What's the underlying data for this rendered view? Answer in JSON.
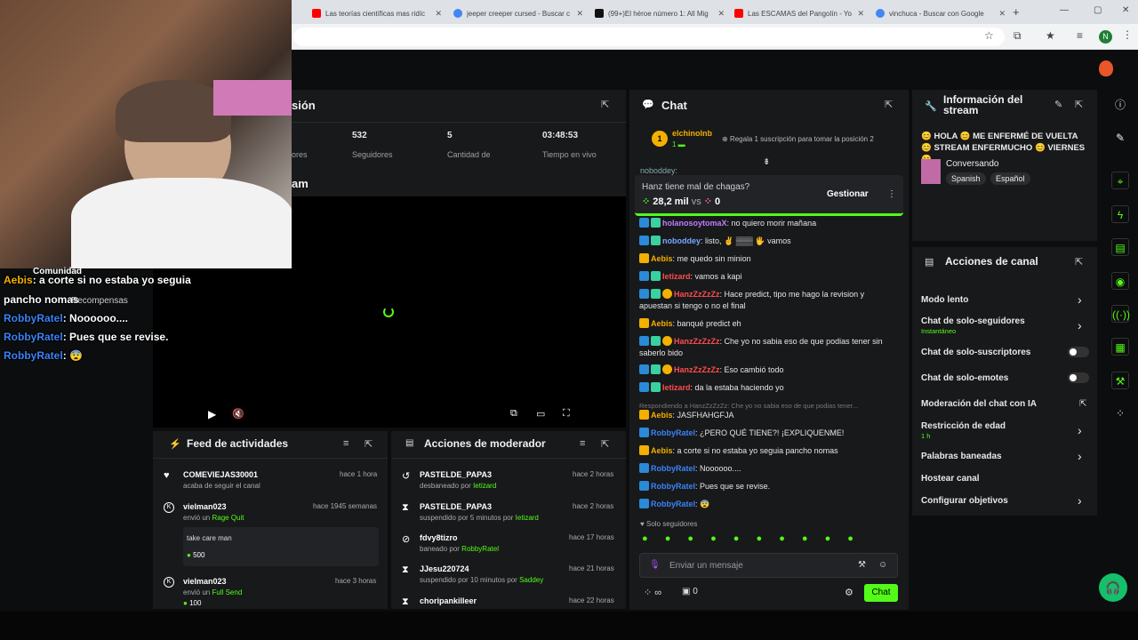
{
  "browser": {
    "tabs": [
      {
        "title": "Las teorías científicas mas ridíc",
        "color": "#ff0000"
      },
      {
        "title": "jeeper creeper cursed - Buscar c",
        "color": "#4285f4"
      },
      {
        "title": "(99+)El héroe número 1: All Mig",
        "color": "#111111"
      },
      {
        "title": "Las ESCAMAS del Pangolín - Yo",
        "color": "#ff0000"
      },
      {
        "title": "vinchuca - Buscar con Google",
        "color": "#4285f4"
      }
    ],
    "new_tab": "+",
    "profile_initial": "N",
    "window_controls": [
      "—",
      "▢",
      "✕"
    ]
  },
  "stream_info": {
    "title_partial": "sión",
    "stats": [
      {
        "value": "",
        "label": "ores"
      },
      {
        "value": "532",
        "label": "Seguidores"
      },
      {
        "value": "5",
        "label": "Cantidad de"
      },
      {
        "value": "03:48:53",
        "label": "Tiempo en vivo"
      }
    ],
    "player_title_partial": "am"
  },
  "overlay": {
    "community_label": "Comunidad",
    "lines": [
      {
        "user": "Aebis",
        "text": " a corte si no estaba yo seguia",
        "color": "#f3b000"
      },
      {
        "user": "",
        "text": "pancho nomas",
        "color": "#ffffff"
      },
      {
        "user": "RobbyRatel",
        "text": "Noooooo....",
        "color": "#3b82f6"
      },
      {
        "user": "RobbyRatel",
        "text": "Pues que se revise.",
        "color": "#3b82f6"
      },
      {
        "user": "RobbyRatel",
        "text": "😨",
        "color": "#3b82f6"
      }
    ],
    "recompensas": "Recompensas"
  },
  "activity_feed": {
    "title": "Feed de actividades",
    "items": [
      {
        "user": "COMEVIEJAS30001",
        "time": "hace 1 hora",
        "desc": "acaba de seguir el canal",
        "highlight": "",
        "icon": "heart-icon"
      },
      {
        "user": "vielman023",
        "time": "hace 1945 semanas",
        "desc": "envió un",
        "highlight": "Rage Quit",
        "icon": "kick-icon",
        "message": "take care man",
        "amount": "500"
      },
      {
        "user": "vielman023",
        "time": "hace 3 horas",
        "desc": "envió un",
        "highlight": "Full Send",
        "icon": "kick-icon",
        "amount": "100"
      }
    ]
  },
  "mod_actions": {
    "title": "Acciones de moderador",
    "items": [
      {
        "user": "PASTELDE_PAPA3",
        "time": "hace 2 horas",
        "desc": "desbaneado por",
        "by": "Ietizard",
        "icon": "undo-icon"
      },
      {
        "user": "PASTELDE_PAPA3",
        "time": "hace 2 horas",
        "desc": "suspendido por 5 minutos por",
        "by": "Ietizard",
        "icon": "hourglass-icon"
      },
      {
        "user": "fdvy8tizro",
        "time": "hace 17 horas",
        "desc": "baneado por",
        "by": "RobbyRatel",
        "icon": "ban-icon"
      },
      {
        "user": "JJesu220724",
        "time": "hace 21 horas",
        "desc": "suspendido por 10 minutos por",
        "by": "Saddey",
        "icon": "hourglass-icon"
      },
      {
        "user": "choripankilleer",
        "time": "hace 22 horas",
        "desc": "",
        "by": "",
        "icon": "hourglass-icon"
      }
    ]
  },
  "chat": {
    "title": "Chat",
    "pinned_user": "elchinolnb",
    "pinned_rank": "1",
    "subs_prompt": "Regala 1 suscripción para tomar la posición 2",
    "top_user": "noboddey:",
    "prediction": {
      "question": "Hanz tiene mal de chagas?",
      "left": "28,2 mil",
      "vs": "vs",
      "right": "0",
      "manage": "Gestionar"
    },
    "messages": [
      {
        "user": "holanosoytomaX",
        "text": "no quiero morir mañana",
        "color": "#c07cff"
      },
      {
        "user": "noboddey",
        "text": "listo, ✌ ▒▒▒ 🖐 vamos",
        "color": "#7aa8ff"
      },
      {
        "user": "Aebis",
        "text": "me quedo sin minion",
        "color": "#f3b000"
      },
      {
        "user": "Ietizard",
        "text": "vamos a kapi",
        "color": "#ff4d4d"
      },
      {
        "user": "HanzZzZzZz",
        "text": "Hace predict, tipo me hago la revision y apuestan si tengo o no el final",
        "color": "#ff4d4d"
      },
      {
        "user": "Aebis",
        "text": "banqué predict eh",
        "color": "#f3b000"
      },
      {
        "user": "HanzZzZzZz",
        "text": "Che yo no sabia eso de que podias tener sin saberlo bido",
        "color": "#ff4d4d"
      },
      {
        "user": "HanzZzZzZz",
        "text": "Eso cambió todo",
        "color": "#ff4d4d"
      },
      {
        "user": "Ietizard",
        "text": "da la estaba haciendo yo",
        "color": "#ff4d4d"
      },
      {
        "user": "Aebis",
        "text": "JASFHAHGFJA",
        "color": "#f3b000"
      },
      {
        "user": "RobbyRatel",
        "text": "¿PERO QUÉ TIENE?! ¡EXPLIQUENME!",
        "color": "#3b82f6"
      },
      {
        "user": "Aebis",
        "text": "a corte si no estaba yo seguia pancho nomas",
        "color": "#f3b000"
      },
      {
        "user": "RobbyRatel",
        "text": "Noooooo....",
        "color": "#3b82f6"
      },
      {
        "user": "RobbyRatel",
        "text": "Pues que se revise.",
        "color": "#3b82f6"
      },
      {
        "user": "RobbyRatel",
        "text": "😨",
        "color": "#3b82f6"
      }
    ],
    "reply_hint": "Respondiendo a HanzZzZzZz: Che yo no sabia eso de que podias tener...",
    "followers_only": "Solo seguidores",
    "input_placeholder": "Enviar un mensaje",
    "infinity": "∞",
    "count": "0",
    "send": "Chat"
  },
  "info": {
    "title": "Información del stream",
    "stream_title": "😊 HOLA 😊 ME ENFERMÉ DE VUELTA 😊 STREAM ENFERMUCHO 😊 VIERNES 😊 ...",
    "category": "Conversando",
    "tags": [
      "Spanish",
      "Español"
    ]
  },
  "channel_actions": {
    "title": "Acciones de canal",
    "items": [
      {
        "label": "Modo lento",
        "sub": "",
        "control": "chevron"
      },
      {
        "label": "Chat de solo-seguidores",
        "sub": "Instantáneo",
        "control": "chevron"
      },
      {
        "label": "Chat de solo-suscriptores",
        "sub": "",
        "control": "toggle"
      },
      {
        "label": "Chat de solo-emotes",
        "sub": "",
        "control": "toggle"
      },
      {
        "label": "Moderación del chat con IA",
        "sub": "",
        "control": "external"
      },
      {
        "label": "Restricción de edad",
        "sub": "1 h",
        "control": "chevron"
      },
      {
        "label": "Palabras baneadas",
        "sub": "",
        "control": "chevron"
      },
      {
        "label": "Hostear canal",
        "sub": "",
        "control": "none"
      },
      {
        "label": "Configurar objetivos",
        "sub": "",
        "control": "chevron"
      }
    ]
  },
  "colors": {
    "accent": "#53fc18",
    "panel": "#18191b",
    "bg": "#0c0d0e"
  }
}
